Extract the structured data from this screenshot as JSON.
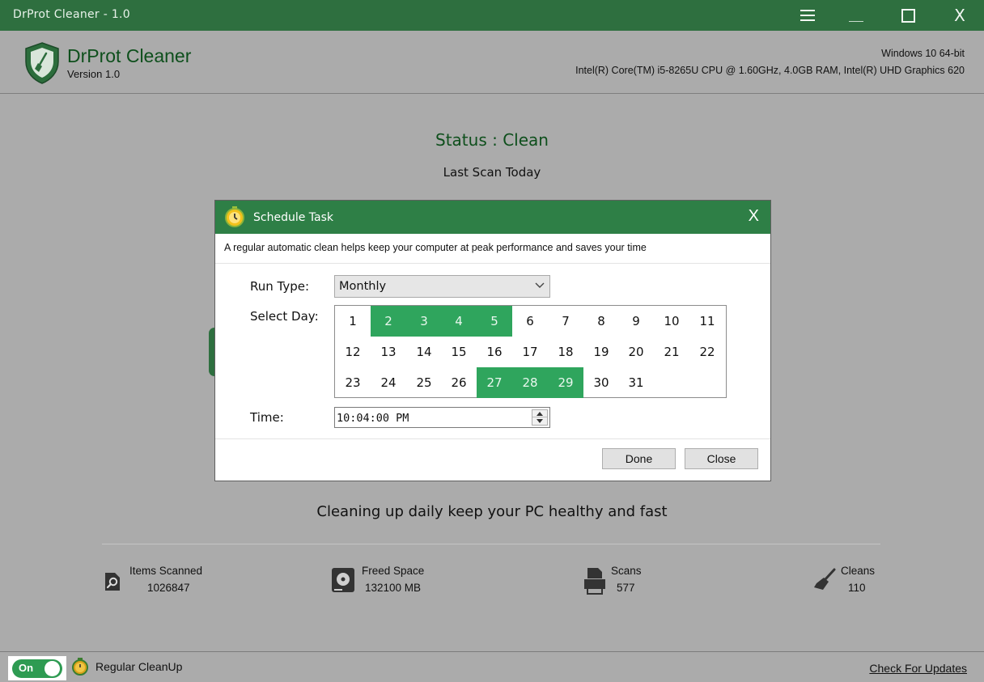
{
  "window": {
    "title": "DrProt Cleaner - 1.0",
    "close_glyph": "X"
  },
  "header": {
    "app_name": "DrProt Cleaner",
    "version": "Version 1.0",
    "os": "Windows 10 64-bit",
    "hardware": "Intel(R) Core(TM) i5-8265U CPU @ 1.60GHz, 4.0GB RAM, Intel(R) UHD Graphics 620"
  },
  "main": {
    "status": "Status : Clean",
    "last_scan": "Last Scan Today",
    "tagline": "Cleaning up daily keep your PC healthy and fast"
  },
  "stats": [
    {
      "label": "Items Scanned",
      "value": "1026847",
      "icon": "search-document-icon"
    },
    {
      "label": "Freed Space",
      "value": "132100 MB",
      "icon": "hard-drive-icon"
    },
    {
      "label": "Scans",
      "value": "577",
      "icon": "printer-icon"
    },
    {
      "label": "Cleans",
      "value": "110",
      "icon": "broom-icon"
    }
  ],
  "footer": {
    "toggle_label": "On",
    "toggle_on": true,
    "regular_cleanup": "Regular CleanUp",
    "check_updates": "Check For Updates"
  },
  "dialog": {
    "title": "Schedule Task",
    "close_glyph": "X",
    "description": "A regular automatic clean helps keep your computer at peak performance and saves your time",
    "run_type_label": "Run Type:",
    "run_type_value": "Monthly",
    "select_day_label": "Select Day:",
    "days": [
      "1",
      "2",
      "3",
      "4",
      "5",
      "6",
      "7",
      "8",
      "9",
      "10",
      "11",
      "12",
      "13",
      "14",
      "15",
      "16",
      "17",
      "18",
      "19",
      "20",
      "21",
      "22",
      "23",
      "24",
      "25",
      "26",
      "27",
      "28",
      "29",
      "30",
      "31"
    ],
    "selected_days": [
      2,
      3,
      4,
      5,
      27,
      28,
      29
    ],
    "time_label": "Time:",
    "time_value": "10:04:00 PM",
    "done_label": "Done",
    "close_label": "Close"
  },
  "colors": {
    "titlebar": "#2e6f3f",
    "accent_green": "#2fa55d",
    "status_text": "#0e4f1c",
    "window_bg": "#ababab"
  }
}
